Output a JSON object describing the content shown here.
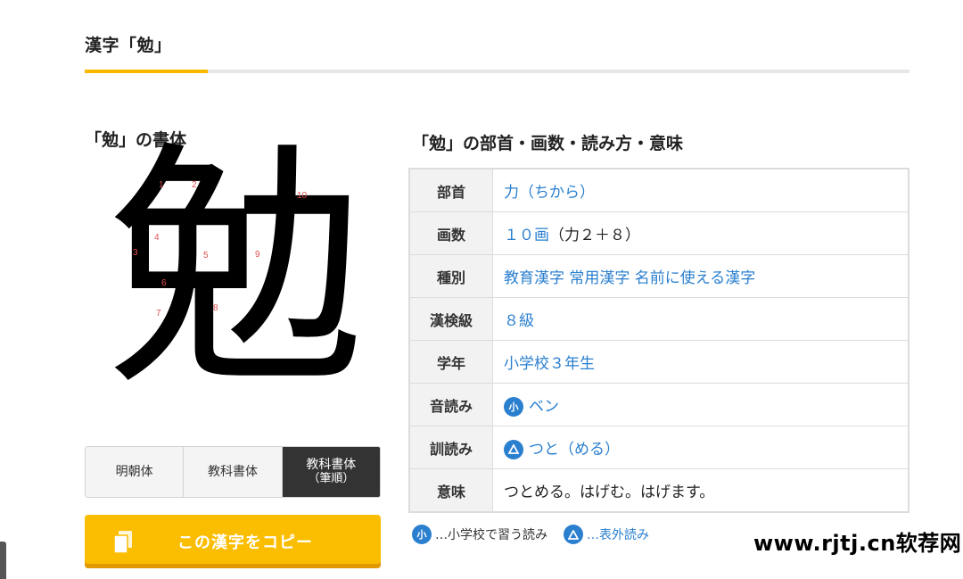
{
  "section": {
    "title": "漢字「勉」"
  },
  "shotai": {
    "title": "「勉」の書体",
    "kanji": "勉",
    "stroke_numbers": [
      "1",
      "2",
      "3",
      "4",
      "5",
      "6",
      "7",
      "8",
      "9",
      "10"
    ]
  },
  "font_tabs": [
    {
      "label": "明朝体",
      "sub": ""
    },
    {
      "label": "教科書体",
      "sub": ""
    },
    {
      "label": "教科書体",
      "sub": "（筆順）",
      "active": true
    }
  ],
  "copy_button": {
    "label": "この漢字をコピー",
    "icon": "copy-icon"
  },
  "info": {
    "title": "「勉」の部首・画数・読み方・意味",
    "rows": [
      {
        "label": "部首",
        "value": "力（ちから）"
      },
      {
        "label": "画数",
        "value": "１０画",
        "extra": "（力２＋８）"
      },
      {
        "label": "種別",
        "value": "教育漢字 常用漢字 名前に使える漢字"
      },
      {
        "label": "漢検級",
        "value": "８級"
      },
      {
        "label": "学年",
        "value": "小学校３年生"
      },
      {
        "label": "音読み",
        "badge": "小",
        "value": "ベン"
      },
      {
        "label": "訓読み",
        "badge": "triangle",
        "value": "つと（める）"
      },
      {
        "label": "意味",
        "value": "つとめる。はげむ。はげます。"
      }
    ]
  },
  "legend": {
    "elementary_badge": "小",
    "elementary_text": "…小学校で習う読み",
    "outside_text": "…表外読み"
  },
  "watermark": "www.rjtj.cn软荐网",
  "colors": {
    "accent": "#fbbd00",
    "link": "#2a7fcf",
    "active_tab": "#333333"
  }
}
